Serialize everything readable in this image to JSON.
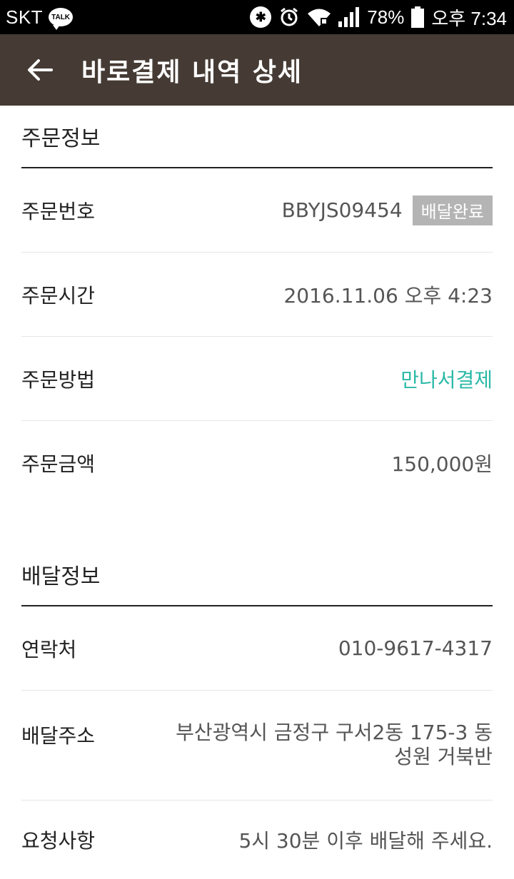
{
  "status_bar": {
    "carrier": "SKT",
    "talk_badge": "TALK",
    "battery": "78%",
    "time": "오후 7:34"
  },
  "app_bar": {
    "back_icon": "arrow-left-icon",
    "title": "바로결제 내역 상세"
  },
  "order_info": {
    "heading": "주문정보",
    "order_number_label": "주문번호",
    "order_number": "BBYJS09454",
    "status_badge": "배달완료",
    "order_time_label": "주문시간",
    "order_time": "2016.11.06 오후 4:23",
    "order_method_label": "주문방법",
    "order_method": "만나서결제",
    "order_amount_label": "주문금액",
    "order_amount": "150,000원"
  },
  "delivery_info": {
    "heading": "배달정보",
    "contact_label": "연락처",
    "contact": "010-9617-4317",
    "address_label": "배달주소",
    "address_line1": "부산광역시 금정구 구서2동 175-3 동",
    "address_line2": "성원 거북반",
    "request_label": "요청사항",
    "request": "5시 30분 이후 배달해 주세요."
  },
  "colors": {
    "app_bar_bg": "#453b34",
    "accent": "#2bb9a7",
    "badge_bg": "#b4b4b4"
  }
}
